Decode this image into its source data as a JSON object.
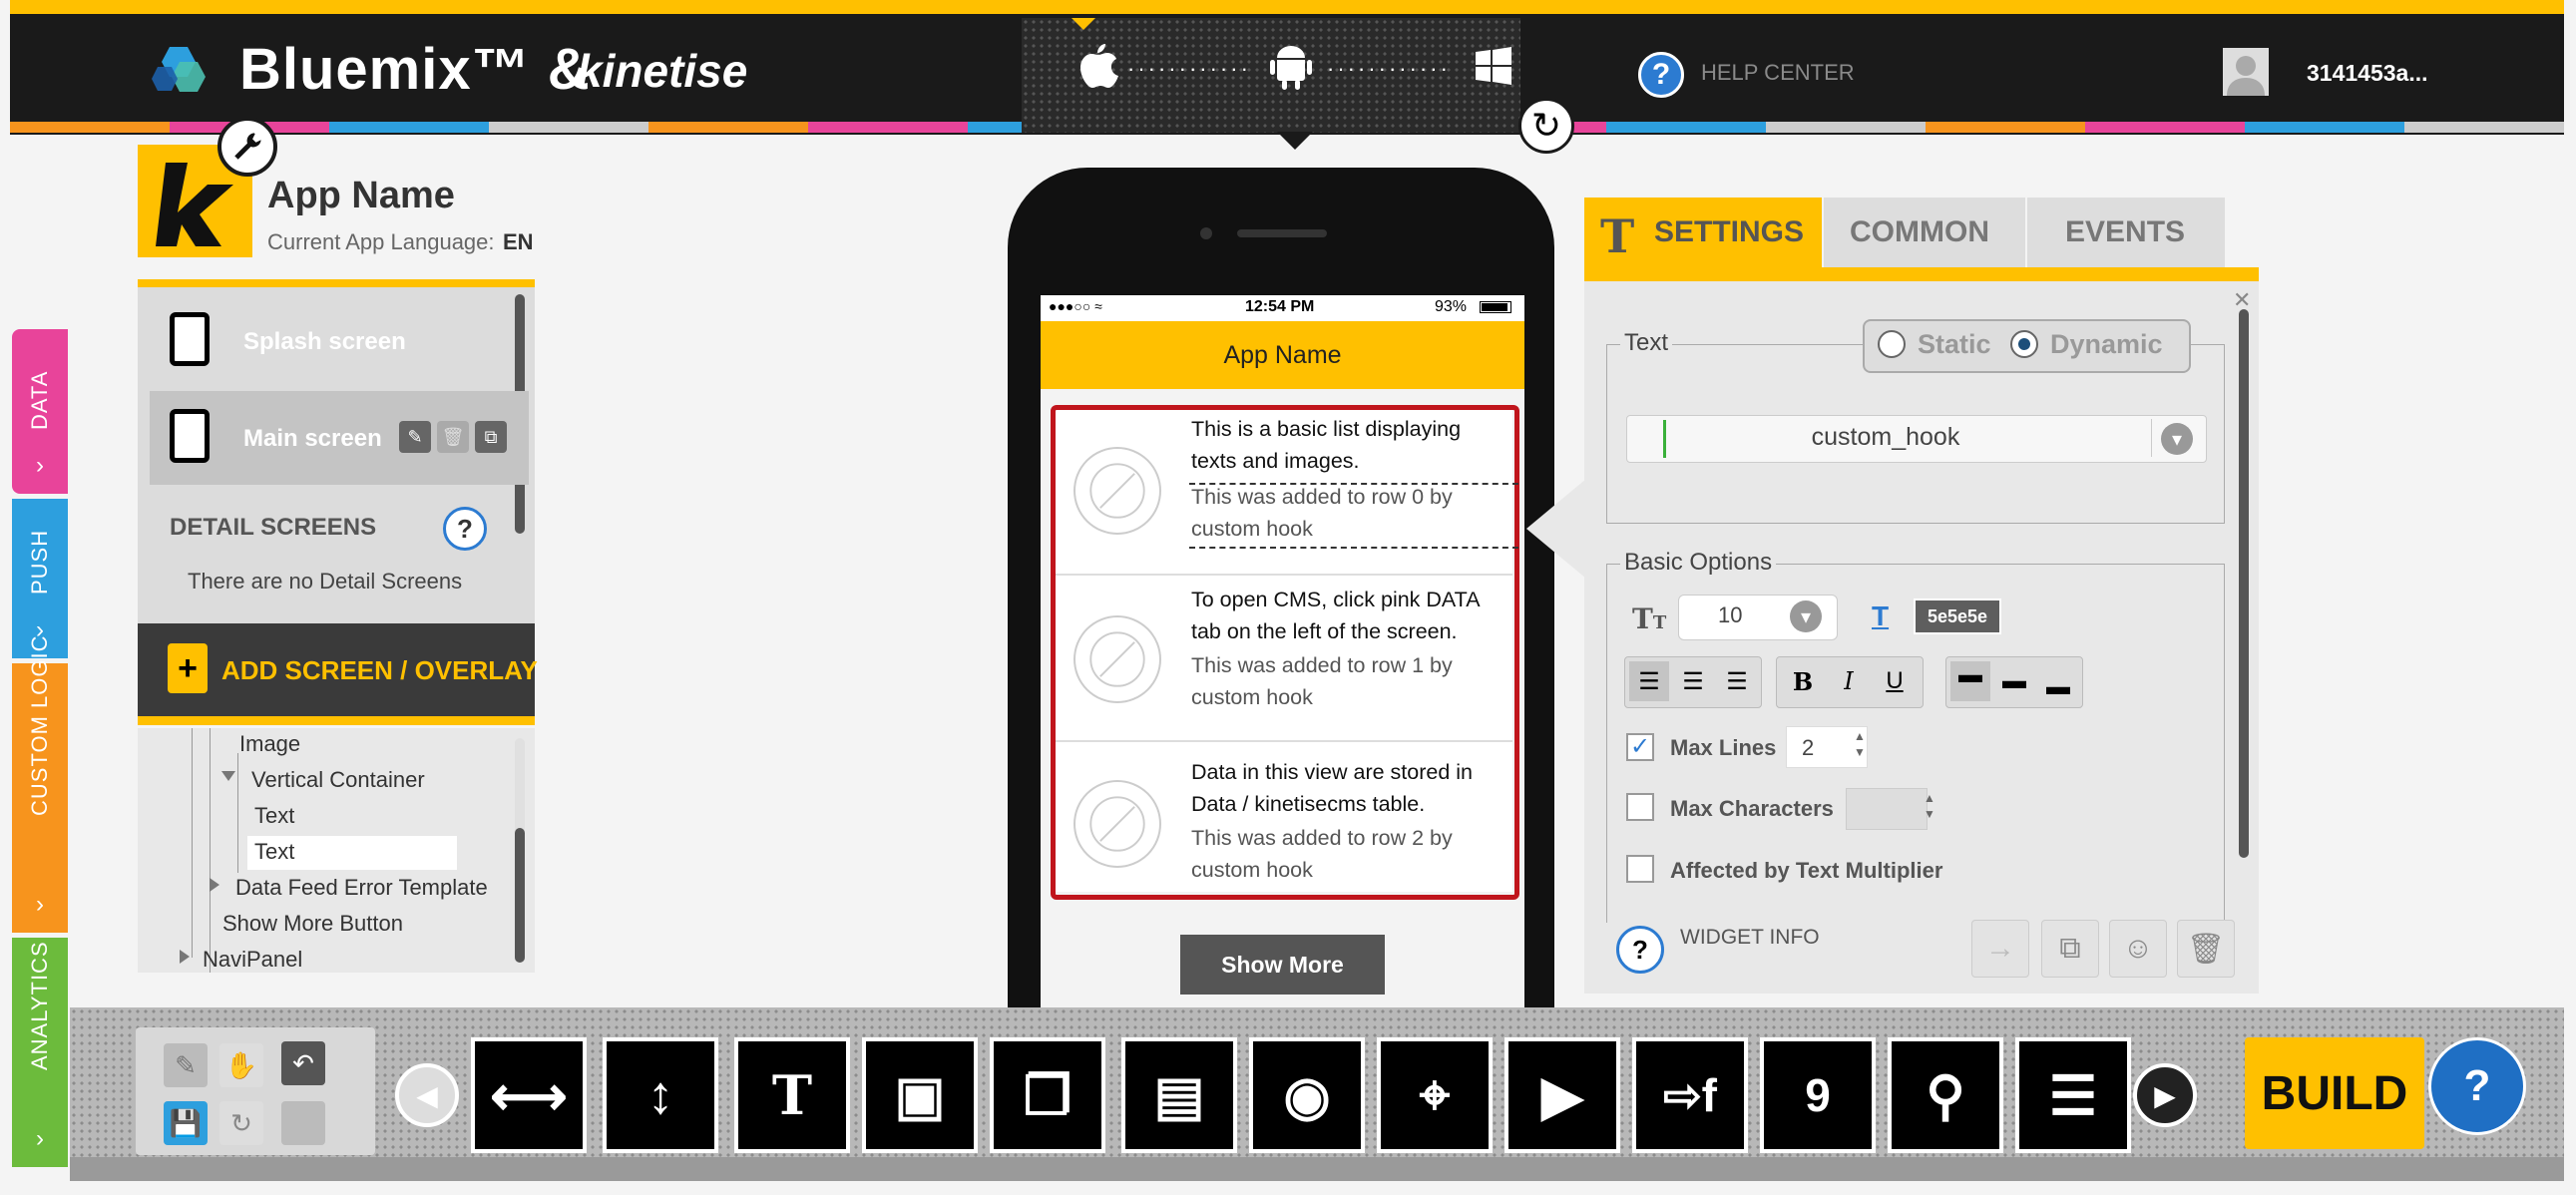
{
  "colors": {
    "brand_yellow": "#ffc000",
    "dark": "#1a1a1a",
    "highlight_red": "#c0151c",
    "data_tab": "#e8449a",
    "push_tab": "#2d9fde",
    "logic_tab": "#f7941d",
    "analytics_tab": "#6cbb3c",
    "strip": [
      "#f7941d",
      "#e8449a",
      "#2d9fde",
      "#cccccc",
      "#f7941d",
      "#e8449a",
      "#2d9fde",
      "#cccccc",
      "#f7941d",
      "#e8449a",
      "#2d9fde",
      "#cccccc",
      "#f7941d",
      "#e8449a",
      "#2d9fde",
      "#cccccc"
    ]
  },
  "header": {
    "brand": "Bluemix™ &",
    "brand2": "kinetise",
    "platforms": [
      "apple-icon",
      "android-icon",
      "windows-icon"
    ],
    "help": "HELP CENTER",
    "user": "3141453a..."
  },
  "sidetabs": {
    "data": "DATA",
    "push": "PUSH",
    "logic": "CUSTOM LOGIC",
    "analytics": "ANALYTICS",
    "arrow": "›"
  },
  "app": {
    "name": "App Name",
    "lang_label": "Current App Language:",
    "lang": "EN"
  },
  "screens": {
    "items": [
      {
        "label": "Splash screen"
      },
      {
        "label": "Main screen"
      }
    ],
    "detail_title": "DETAIL SCREENS",
    "detail_empty": "There are no Detail Screens",
    "add_label": "ADD SCREEN / OVERLAY"
  },
  "tree": {
    "items": [
      "Image",
      "Vertical Container",
      "Text",
      "Text",
      "Data Feed Error Template",
      "Show More Button",
      "NaviPanel"
    ]
  },
  "phone": {
    "status_time": "12:54 PM",
    "status_battery": "93%",
    "title": "App Name",
    "rows": [
      {
        "title": "This is a basic list displaying texts and images.",
        "sub": "This was added to row 0 by custom hook"
      },
      {
        "title": "To open CMS, click pink DATA tab on the left of the screen.",
        "sub": "This was added to row 1 by custom hook"
      },
      {
        "title": "Data in this view are stored in Data / kinetisecms table.",
        "sub": "This was added to row 2 by custom hook"
      }
    ],
    "show_more": "Show More"
  },
  "panel": {
    "tabs": {
      "settings": "SETTINGS",
      "common": "COMMON",
      "events": "EVENTS"
    },
    "text_legend": "Text",
    "static": "Static",
    "dynamic": "Dynamic",
    "mode_selected": "Dynamic",
    "hook_value": "custom_hook",
    "basic_legend": "Basic Options",
    "font_size": "10",
    "color_value": "5e5e5e",
    "max_lines_label": "Max Lines",
    "max_lines_value": "2",
    "max_lines_checked": true,
    "max_chars_label": "Max Characters",
    "multiplier_label": "Affected by Text Multiplier",
    "widget_info": "WIDGET INFO"
  },
  "toolbar": {
    "build": "BUILD"
  }
}
